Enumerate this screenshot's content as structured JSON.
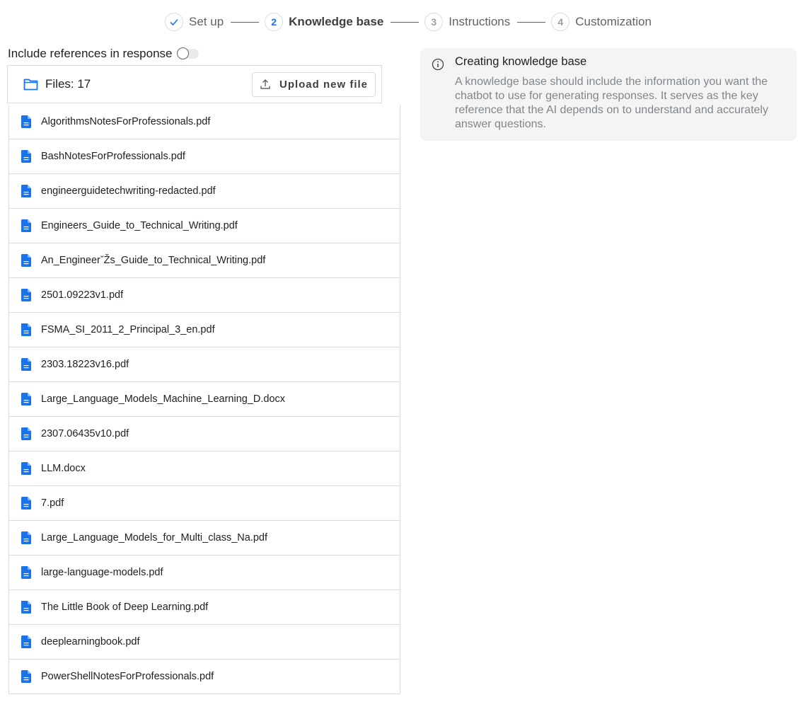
{
  "stepper": {
    "steps": [
      {
        "number": "",
        "label": "Set up",
        "state": "done",
        "icon": "check-icon"
      },
      {
        "number": "2",
        "label": "Knowledge base",
        "state": "active"
      },
      {
        "number": "3",
        "label": "Instructions",
        "state": "pending"
      },
      {
        "number": "4",
        "label": "Customization",
        "state": "pending"
      }
    ]
  },
  "references": {
    "label": "Include references in response",
    "enabled": false
  },
  "files": {
    "count_label": "Files: 17",
    "upload_label": "Upload new file",
    "icon": "folder-icon",
    "items": [
      "AlgorithmsNotesForProfessionals.pdf",
      "BashNotesForProfessionals.pdf",
      "engineerguidetechwriting-redacted.pdf",
      "Engineers_Guide_to_Technical_Writing.pdf",
      "An_EngineerˇŽs_Guide_to_Technical_Writing.pdf",
      "2501.09223v1.pdf",
      "FSMA_SI_2011_2_Principal_3_en.pdf",
      "2303.18223v16.pdf",
      "Large_Language_Models_Machine_Learning_D.docx",
      "2307.06435v10.pdf",
      "LLM.docx",
      "7.pdf",
      "Large_Language_Models_for_Multi_class_Na.pdf",
      "large-language-models.pdf",
      "The Little Book of Deep Learning.pdf",
      "deeplearningbook.pdf",
      "PowerShellNotesForProfessionals.pdf"
    ]
  },
  "info": {
    "title": "Creating knowledge base",
    "text": "A knowledge base should include the information you want the chatbot to use for generating responses. It serves as the key reference that the AI depends on to understand and accurately answer questions."
  },
  "colors": {
    "accent": "#1a73e8",
    "file_icon": "#1a73e8",
    "info_bg": "#f4f4f4"
  }
}
